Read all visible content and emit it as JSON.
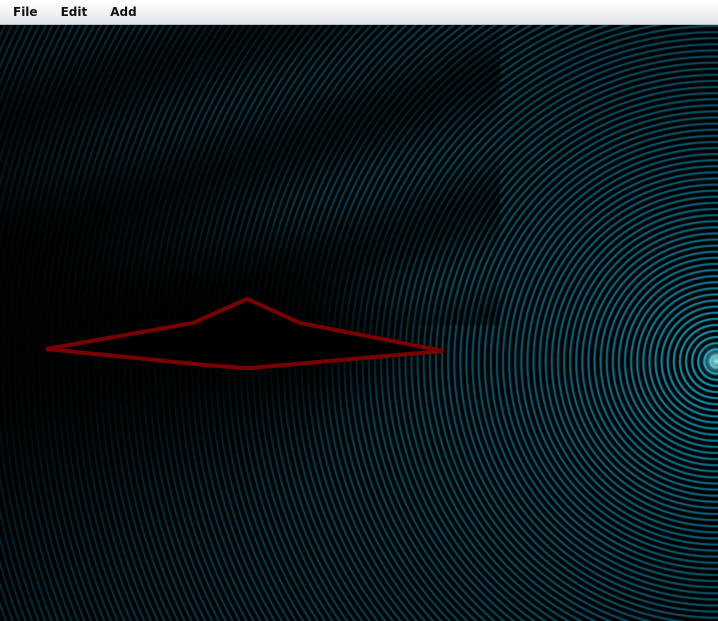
{
  "menubar": {
    "items": [
      {
        "label": "File"
      },
      {
        "label": "Edit"
      },
      {
        "label": "Add"
      }
    ]
  },
  "simulation": {
    "wave_color": "#1fa3c8",
    "wall_color": "#7a0000",
    "background": "#000000"
  }
}
